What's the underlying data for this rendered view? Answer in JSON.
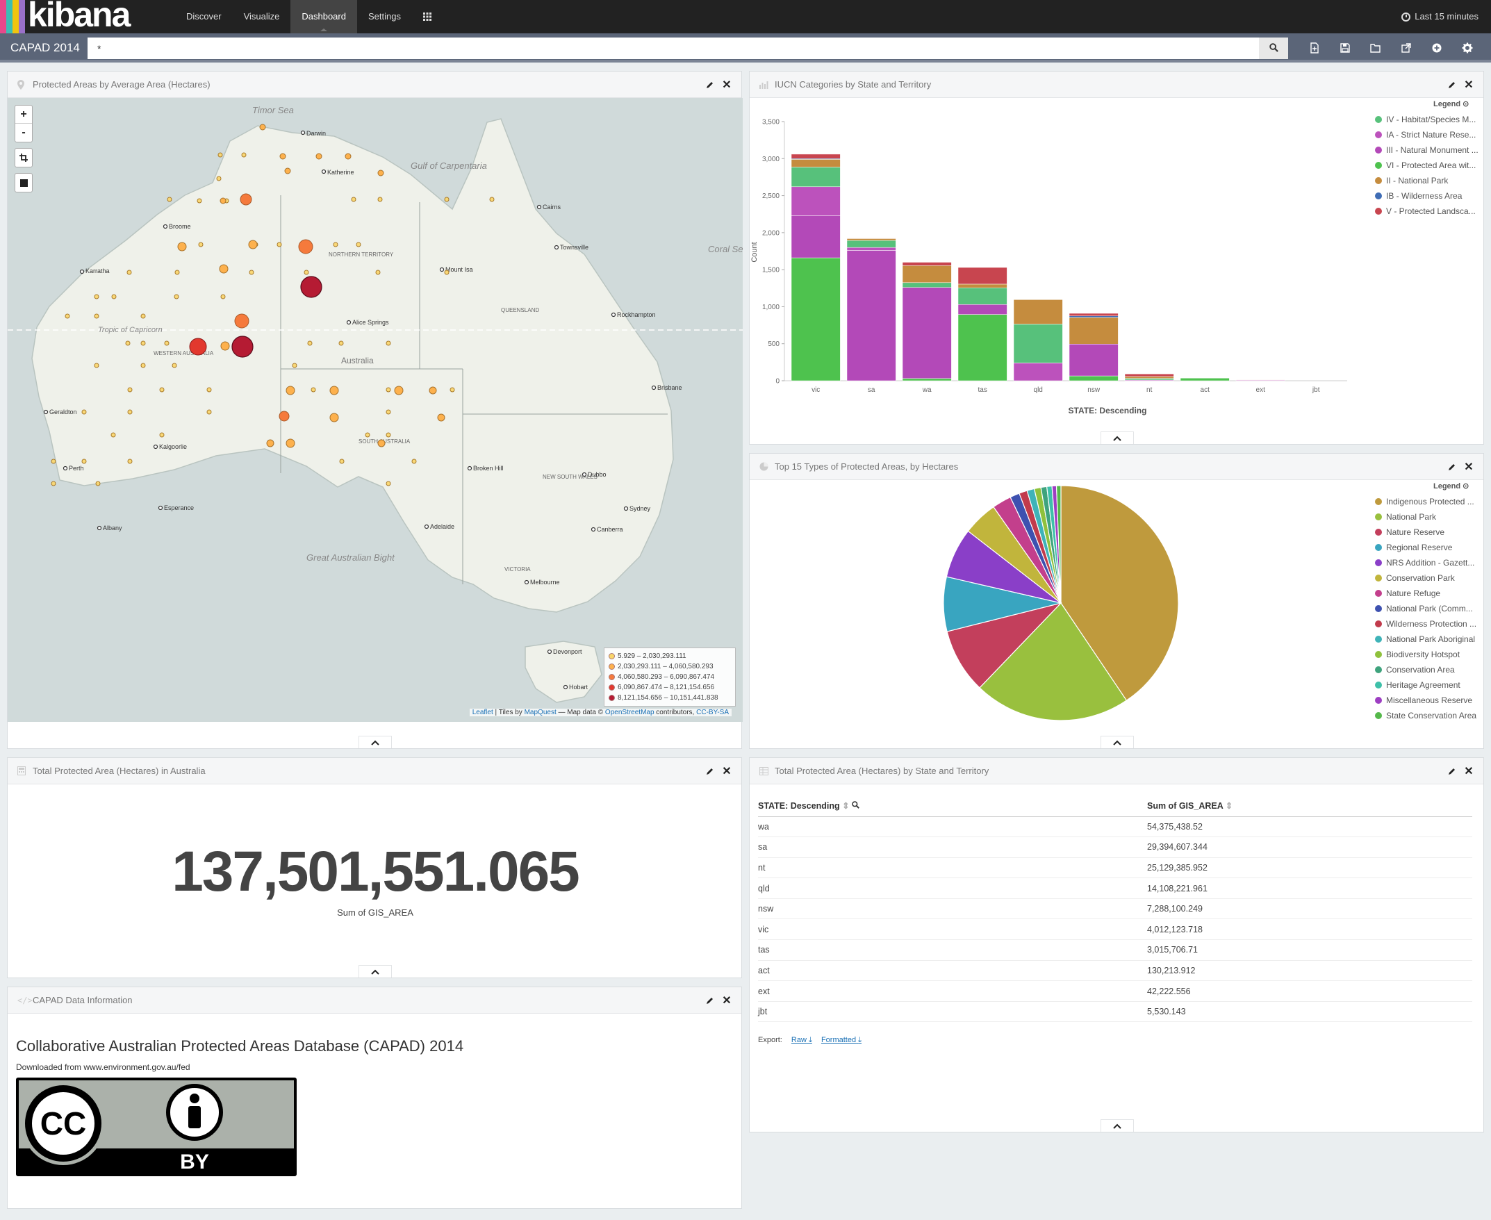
{
  "navbar": {
    "logo_text": "kibana",
    "stripe_colors": [
      "#e8488b",
      "#3cbeb5",
      "#f1c40f",
      "#9a70c9",
      "#a4c639"
    ],
    "links": [
      "Discover",
      "Visualize",
      "Dashboard",
      "Settings"
    ],
    "active_link": "Dashboard",
    "apps_icon": "grid-icon",
    "time_label": "Last 15 minutes"
  },
  "subbar": {
    "dashboard_title": "CAPAD 2014",
    "query_value": "*",
    "toolbar_icons": [
      "new-dashboard-icon",
      "save-icon",
      "open-icon",
      "share-icon",
      "add-visualization-icon",
      "options-gear-icon"
    ]
  },
  "map_panel": {
    "title": "Protected Areas by Average Area (Hectares)",
    "zoom_in": "+",
    "zoom_out": "-",
    "legend": [
      {
        "range": "5.929 – 2,030,293.111",
        "color": "#f9d56a"
      },
      {
        "range": "2,030,293.111 – 4,060,580.293",
        "color": "#fdb14d"
      },
      {
        "range": "4,060,580.293 – 6,090,867.474",
        "color": "#f57a3c"
      },
      {
        "range": "6,090,867.474 – 8,121,154.656",
        "color": "#e2382e"
      },
      {
        "range": "8,121,154.656 – 10,151,441.838",
        "color": "#b51b33"
      }
    ],
    "attribution": {
      "leaflet": "Leaflet",
      "tiles_by": " | Tiles by ",
      "mapquest": "MapQuest",
      "map_data": " — Map data © ",
      "osm": "OpenStreetMap",
      "contributors": " contributors, ",
      "license": "CC-BY-SA"
    },
    "labels": {
      "timor_sea": "Timor Sea",
      "gulf": "Gulf of Carpentaria",
      "coral_sea": "Coral Sea",
      "bight": "Great Australian Bight",
      "australia": "Australia",
      "tropic": "Tropic of Capricorn",
      "nt": "NORTHERN TERRITORY",
      "wa": "WESTERN AUSTRALIA",
      "qld": "QUEENSLAND",
      "sa": "SOUTH AUSTRALIA",
      "nsw": "NEW SOUTH WALES",
      "vic": "VICTORIA",
      "darwin": "Darwin",
      "katherine": "Katherine",
      "broome": "Broome",
      "karratha": "Karratha",
      "alice": "Alice Springs",
      "perth": "Perth",
      "kalgoorlie": "Kalgoorlie",
      "adelaide": "Adelaide",
      "melbourne": "Melbourne",
      "sydney": "Sydney",
      "canberra": "Canberra",
      "brisbane": "Brisbane",
      "townsville": "Townsville",
      "cairns": "Cairns",
      "mount_isa": "Mount Isa",
      "hobart": "Hobart",
      "broken_hill": "Broken Hill",
      "geraldton": "Geraldton",
      "albany": "Albany",
      "esperance": "Esperance",
      "rockhampton": "Rockhampton",
      "dubbo": "Dubbo",
      "devonport": "Devonport"
    }
  },
  "iucn_panel": {
    "title": "IUCN Categories by State and Territory",
    "legend_title": "Legend",
    "series_legend": [
      {
        "name": "IV - Habitat/Species M...",
        "color": "#57c17b"
      },
      {
        "name": "IA - Strict Nature Rese...",
        "color": "#bc52bc"
      },
      {
        "name": "III - Natural Monument ...",
        "color": "#b349b8"
      },
      {
        "name": "VI - Protected Area wit...",
        "color": "#4ec24e"
      },
      {
        "name": "II - National Park",
        "color": "#c58c3e"
      },
      {
        "name": "IB - Wilderness Area",
        "color": "#3f6db5"
      },
      {
        "name": "V - Protected Landsca...",
        "color": "#c8454f"
      }
    ]
  },
  "chart_data": [
    {
      "type": "bar",
      "stacked": true,
      "categories": [
        "vic",
        "sa",
        "wa",
        "tas",
        "qld",
        "nsw",
        "nt",
        "act",
        "ext",
        "jbt"
      ],
      "xlabel": "STATE: Descending",
      "ylabel": "Count",
      "ylim": [
        0,
        3500
      ],
      "yticks": [
        "0",
        "500",
        "1,000",
        "1,500",
        "2,000",
        "2,500",
        "3,000",
        "3,500"
      ],
      "series": [
        {
          "name": "VI - Protected Area wit...",
          "color": "#4ec24e",
          "values": [
            1660,
            0,
            30,
            895,
            0,
            65,
            0,
            38,
            0,
            0
          ]
        },
        {
          "name": "III - Natural Monument ...",
          "color": "#b349b8",
          "values": [
            570,
            1760,
            1230,
            135,
            0,
            430,
            0,
            0,
            0,
            0
          ]
        },
        {
          "name": "IA - Strict Nature Rese...",
          "color": "#bc52bc",
          "values": [
            390,
            40,
            0,
            0,
            240,
            0,
            10,
            0,
            8,
            0
          ]
        },
        {
          "name": "IV - Habitat/Species M...",
          "color": "#57c17b",
          "values": [
            265,
            95,
            65,
            225,
            525,
            0,
            22,
            0,
            0,
            0
          ]
        },
        {
          "name": "II - National Park",
          "color": "#c58c3e",
          "values": [
            105,
            25,
            230,
            50,
            330,
            360,
            25,
            0,
            0,
            0
          ]
        },
        {
          "name": "IB - Wilderness Area",
          "color": "#3f6db5",
          "values": [
            10,
            0,
            0,
            0,
            0,
            20,
            0,
            0,
            0,
            0
          ]
        },
        {
          "name": "V - Protected Landsca...",
          "color": "#c8454f",
          "values": [
            60,
            5,
            45,
            225,
            0,
            35,
            35,
            2,
            5,
            0
          ]
        }
      ]
    },
    {
      "type": "pie",
      "slices": [
        {
          "name": "Indigenous Protected ...",
          "value": 40.0,
          "color": "#bf9a3d"
        },
        {
          "name": "National Park",
          "value": 21.3,
          "color": "#99c03e"
        },
        {
          "name": "Nature Reserve",
          "value": 8.8,
          "color": "#c33f5c"
        },
        {
          "name": "Regional Reserve",
          "value": 7.4,
          "color": "#39a5c0"
        },
        {
          "name": "NRS Addition - Gazett...",
          "value": 6.8,
          "color": "#8a3fc8"
        },
        {
          "name": "Conservation Park",
          "value": 4.7,
          "color": "#c1b53c"
        },
        {
          "name": "Nature Refuge",
          "value": 2.6,
          "color": "#c33f8c"
        },
        {
          "name": "National Park (Comm...",
          "value": 1.3,
          "color": "#3e51b0"
        },
        {
          "name": "Wilderness Protection ...",
          "value": 1.1,
          "color": "#c13b4c"
        },
        {
          "name": "National Park Aboriginal",
          "value": 1.0,
          "color": "#3fb3b8"
        },
        {
          "name": "Biodiversity Hotspot",
          "value": 0.9,
          "color": "#8fc13c"
        },
        {
          "name": "Conservation Area",
          "value": 0.8,
          "color": "#3fa37d"
        },
        {
          "name": "Heritage Agreement",
          "value": 0.7,
          "color": "#3ec0a9"
        },
        {
          "name": "Miscellaneous Reserve",
          "value": 0.6,
          "color": "#9d3ec2"
        },
        {
          "name": "State Conservation Area",
          "value": 0.6,
          "color": "#55b84a"
        }
      ]
    },
    {
      "type": "table",
      "columns": [
        "STATE: Descending",
        "Sum of GIS_AREA"
      ],
      "rows": [
        [
          "wa",
          "54,375,438.52"
        ],
        [
          "sa",
          "29,394,607.344"
        ],
        [
          "nt",
          "25,129,385.952"
        ],
        [
          "qld",
          "14,108,221.961"
        ],
        [
          "nsw",
          "7,288,100.249"
        ],
        [
          "vic",
          "4,012,123.718"
        ],
        [
          "tas",
          "3,015,706.71"
        ],
        [
          "act",
          "130,213.912"
        ],
        [
          "ext",
          "42,222.556"
        ],
        [
          "jbt",
          "5,530.143"
        ]
      ]
    }
  ],
  "pie_panel": {
    "title": "Top 15 Types of Protected Areas, by Hectares",
    "legend_title": "Legend"
  },
  "metric_panel": {
    "title": "Total Protected Area (Hectares) in Australia",
    "value": "137,501,551.065",
    "label": "Sum of GIS_AREA"
  },
  "table_panel": {
    "title": "Total Protected Area (Hectares) by State and Territory",
    "col_state": "STATE: Descending",
    "col_sum": "Sum of GIS_AREA",
    "export_label": "Export:",
    "export_raw": "Raw",
    "export_formatted": "Formatted"
  },
  "markdown_panel": {
    "title": "CAPAD Data Information",
    "heading": "Collaborative Australian Protected Areas Database (CAPAD) 2014",
    "source": "Downloaded from www.environment.gov.au/fed",
    "license_badge_text": "CC",
    "badge_by": "BY"
  }
}
